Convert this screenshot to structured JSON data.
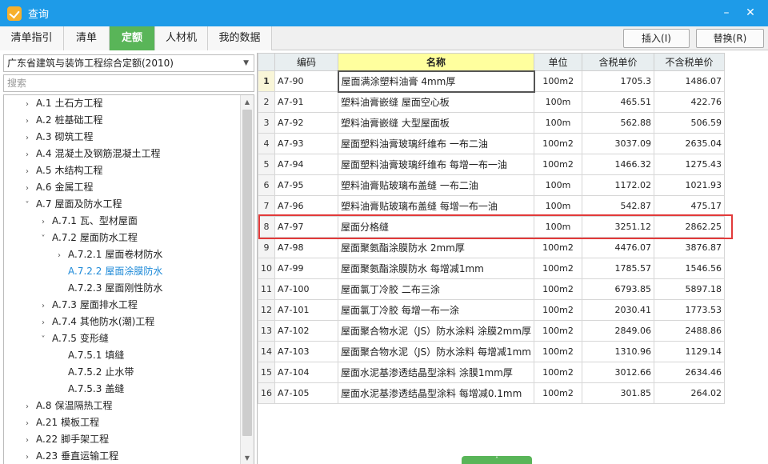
{
  "window": {
    "title": "查询",
    "minimize": "–",
    "close": "✕"
  },
  "tabs": [
    {
      "label": "清单指引",
      "active": false
    },
    {
      "label": "清单",
      "active": false
    },
    {
      "label": "定额",
      "active": true
    },
    {
      "label": "人材机",
      "active": false
    },
    {
      "label": "我的数据",
      "active": false
    }
  ],
  "actions": {
    "insert": "插入(I)",
    "replace": "替换(R)"
  },
  "left": {
    "library": "广东省建筑与装饰工程综合定额(2010)",
    "search_placeholder": "搜索"
  },
  "tree": [
    {
      "indent": 0,
      "arrow": "›",
      "code": "A.1",
      "label": "土石方工程"
    },
    {
      "indent": 0,
      "arrow": "›",
      "code": "A.2",
      "label": "桩基础工程"
    },
    {
      "indent": 0,
      "arrow": "›",
      "code": "A.3",
      "label": "砌筑工程"
    },
    {
      "indent": 0,
      "arrow": "›",
      "code": "A.4",
      "label": "混凝土及钢筋混凝土工程"
    },
    {
      "indent": 0,
      "arrow": "›",
      "code": "A.5",
      "label": "木结构工程"
    },
    {
      "indent": 0,
      "arrow": "›",
      "code": "A.6",
      "label": "金属工程"
    },
    {
      "indent": 0,
      "arrow": "˅",
      "code": "A.7",
      "label": "屋面及防水工程"
    },
    {
      "indent": 1,
      "arrow": "›",
      "code": "A.7.1",
      "label": "瓦、型材屋面"
    },
    {
      "indent": 1,
      "arrow": "˅",
      "code": "A.7.2",
      "label": "屋面防水工程"
    },
    {
      "indent": 2,
      "arrow": "›",
      "code": "A.7.2.1",
      "label": "屋面卷材防水"
    },
    {
      "indent": 2,
      "arrow": "",
      "code": "A.7.2.2",
      "label": "屋面涂膜防水",
      "selected": true
    },
    {
      "indent": 2,
      "arrow": "",
      "code": "A.7.2.3",
      "label": "屋面刚性防水"
    },
    {
      "indent": 1,
      "arrow": "›",
      "code": "A.7.3",
      "label": "屋面排水工程"
    },
    {
      "indent": 1,
      "arrow": "›",
      "code": "A.7.4",
      "label": "其他防水(潮)工程"
    },
    {
      "indent": 1,
      "arrow": "˅",
      "code": "A.7.5",
      "label": "变形缝"
    },
    {
      "indent": 2,
      "arrow": "",
      "code": "A.7.5.1",
      "label": "填缝"
    },
    {
      "indent": 2,
      "arrow": "",
      "code": "A.7.5.2",
      "label": "止水带"
    },
    {
      "indent": 2,
      "arrow": "",
      "code": "A.7.5.3",
      "label": "盖缝"
    },
    {
      "indent": 0,
      "arrow": "›",
      "code": "A.8",
      "label": "保温隔热工程"
    },
    {
      "indent": 0,
      "arrow": "›",
      "code": "A.21",
      "label": "模板工程"
    },
    {
      "indent": 0,
      "arrow": "›",
      "code": "A.22",
      "label": "脚手架工程"
    },
    {
      "indent": 0,
      "arrow": "›",
      "code": "A.23",
      "label": "垂直运输工程"
    }
  ],
  "table": {
    "headers": {
      "code": "编码",
      "name": "名称",
      "unit": "单位",
      "price_tax": "含税单价",
      "price_notax": "不含税单价"
    },
    "rows": [
      {
        "n": "1",
        "code": "A7-90",
        "name": "屋面满涂塑料油膏 4mm厚",
        "unit": "100m2",
        "tax": "1705.3",
        "notax": "1486.07"
      },
      {
        "n": "2",
        "code": "A7-91",
        "name": "塑料油膏嵌缝 屋面空心板",
        "unit": "100m",
        "tax": "465.51",
        "notax": "422.76"
      },
      {
        "n": "3",
        "code": "A7-92",
        "name": "塑料油膏嵌缝 大型屋面板",
        "unit": "100m",
        "tax": "562.88",
        "notax": "506.59"
      },
      {
        "n": "4",
        "code": "A7-93",
        "name": "屋面塑料油膏玻璃纤维布 一布二油",
        "unit": "100m2",
        "tax": "3037.09",
        "notax": "2635.04"
      },
      {
        "n": "5",
        "code": "A7-94",
        "name": "屋面塑料油膏玻璃纤维布 每增一布一油",
        "unit": "100m2",
        "tax": "1466.32",
        "notax": "1275.43"
      },
      {
        "n": "6",
        "code": "A7-95",
        "name": "塑料油膏贴玻璃布盖缝 一布二油",
        "unit": "100m",
        "tax": "1172.02",
        "notax": "1021.93"
      },
      {
        "n": "7",
        "code": "A7-96",
        "name": "塑料油膏贴玻璃布盖缝 每增一布一油",
        "unit": "100m",
        "tax": "542.87",
        "notax": "475.17"
      },
      {
        "n": "8",
        "code": "A7-97",
        "name": "屋面分格缝",
        "unit": "100m",
        "tax": "3251.12",
        "notax": "2862.25"
      },
      {
        "n": "9",
        "code": "A7-98",
        "name": "屋面聚氨酯涂膜防水 2mm厚",
        "unit": "100m2",
        "tax": "4476.07",
        "notax": "3876.87"
      },
      {
        "n": "10",
        "code": "A7-99",
        "name": "屋面聚氨酯涂膜防水 每增减1mm",
        "unit": "100m2",
        "tax": "1785.57",
        "notax": "1546.56"
      },
      {
        "n": "11",
        "code": "A7-100",
        "name": "屋面氯丁冷胶 二布三涂",
        "unit": "100m2",
        "tax": "6793.85",
        "notax": "5897.18"
      },
      {
        "n": "12",
        "code": "A7-101",
        "name": "屋面氯丁冷胶 每增一布一涂",
        "unit": "100m2",
        "tax": "2030.41",
        "notax": "1773.53"
      },
      {
        "n": "13",
        "code": "A7-102",
        "name": "屋面聚合物水泥（JS）防水涂料 涂膜2mm厚",
        "unit": "100m2",
        "tax": "2849.06",
        "notax": "2488.86"
      },
      {
        "n": "14",
        "code": "A7-103",
        "name": "屋面聚合物水泥（JS）防水涂料 每增减1mm",
        "unit": "100m2",
        "tax": "1310.96",
        "notax": "1129.14"
      },
      {
        "n": "15",
        "code": "A7-104",
        "name": "屋面水泥基渗透结晶型涂料 涂膜1mm厚",
        "unit": "100m2",
        "tax": "3012.66",
        "notax": "2634.46"
      },
      {
        "n": "16",
        "code": "A7-105",
        "name": "屋面水泥基渗透结晶型涂料 每增减0.1mm",
        "unit": "100m2",
        "tax": "301.85",
        "notax": "264.02"
      }
    ]
  },
  "bottom": {
    "expand_glyph": "˄"
  }
}
